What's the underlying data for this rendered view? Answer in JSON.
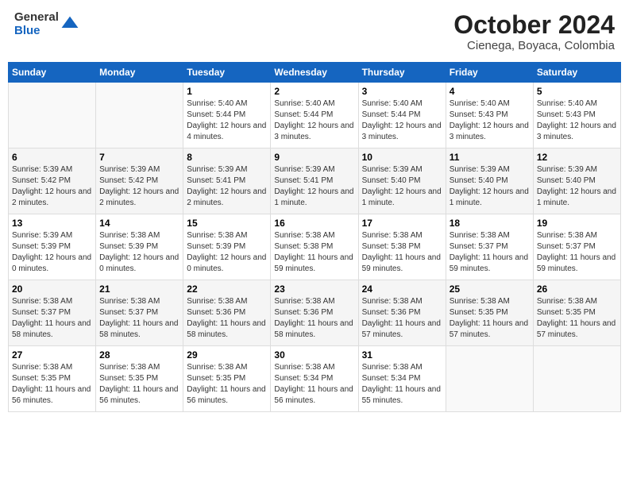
{
  "logo": {
    "general": "General",
    "blue": "Blue"
  },
  "header": {
    "month": "October 2024",
    "location": "Cienega, Boyaca, Colombia"
  },
  "weekdays": [
    "Sunday",
    "Monday",
    "Tuesday",
    "Wednesday",
    "Thursday",
    "Friday",
    "Saturday"
  ],
  "weeks": [
    [
      {
        "day": "",
        "info": ""
      },
      {
        "day": "",
        "info": ""
      },
      {
        "day": "1",
        "info": "Sunrise: 5:40 AM\nSunset: 5:44 PM\nDaylight: 12 hours and 4 minutes."
      },
      {
        "day": "2",
        "info": "Sunrise: 5:40 AM\nSunset: 5:44 PM\nDaylight: 12 hours and 3 minutes."
      },
      {
        "day": "3",
        "info": "Sunrise: 5:40 AM\nSunset: 5:44 PM\nDaylight: 12 hours and 3 minutes."
      },
      {
        "day": "4",
        "info": "Sunrise: 5:40 AM\nSunset: 5:43 PM\nDaylight: 12 hours and 3 minutes."
      },
      {
        "day": "5",
        "info": "Sunrise: 5:40 AM\nSunset: 5:43 PM\nDaylight: 12 hours and 3 minutes."
      }
    ],
    [
      {
        "day": "6",
        "info": "Sunrise: 5:39 AM\nSunset: 5:42 PM\nDaylight: 12 hours and 2 minutes."
      },
      {
        "day": "7",
        "info": "Sunrise: 5:39 AM\nSunset: 5:42 PM\nDaylight: 12 hours and 2 minutes."
      },
      {
        "day": "8",
        "info": "Sunrise: 5:39 AM\nSunset: 5:41 PM\nDaylight: 12 hours and 2 minutes."
      },
      {
        "day": "9",
        "info": "Sunrise: 5:39 AM\nSunset: 5:41 PM\nDaylight: 12 hours and 1 minute."
      },
      {
        "day": "10",
        "info": "Sunrise: 5:39 AM\nSunset: 5:40 PM\nDaylight: 12 hours and 1 minute."
      },
      {
        "day": "11",
        "info": "Sunrise: 5:39 AM\nSunset: 5:40 PM\nDaylight: 12 hours and 1 minute."
      },
      {
        "day": "12",
        "info": "Sunrise: 5:39 AM\nSunset: 5:40 PM\nDaylight: 12 hours and 1 minute."
      }
    ],
    [
      {
        "day": "13",
        "info": "Sunrise: 5:39 AM\nSunset: 5:39 PM\nDaylight: 12 hours and 0 minutes."
      },
      {
        "day": "14",
        "info": "Sunrise: 5:38 AM\nSunset: 5:39 PM\nDaylight: 12 hours and 0 minutes."
      },
      {
        "day": "15",
        "info": "Sunrise: 5:38 AM\nSunset: 5:39 PM\nDaylight: 12 hours and 0 minutes."
      },
      {
        "day": "16",
        "info": "Sunrise: 5:38 AM\nSunset: 5:38 PM\nDaylight: 11 hours and 59 minutes."
      },
      {
        "day": "17",
        "info": "Sunrise: 5:38 AM\nSunset: 5:38 PM\nDaylight: 11 hours and 59 minutes."
      },
      {
        "day": "18",
        "info": "Sunrise: 5:38 AM\nSunset: 5:37 PM\nDaylight: 11 hours and 59 minutes."
      },
      {
        "day": "19",
        "info": "Sunrise: 5:38 AM\nSunset: 5:37 PM\nDaylight: 11 hours and 59 minutes."
      }
    ],
    [
      {
        "day": "20",
        "info": "Sunrise: 5:38 AM\nSunset: 5:37 PM\nDaylight: 11 hours and 58 minutes."
      },
      {
        "day": "21",
        "info": "Sunrise: 5:38 AM\nSunset: 5:37 PM\nDaylight: 11 hours and 58 minutes."
      },
      {
        "day": "22",
        "info": "Sunrise: 5:38 AM\nSunset: 5:36 PM\nDaylight: 11 hours and 58 minutes."
      },
      {
        "day": "23",
        "info": "Sunrise: 5:38 AM\nSunset: 5:36 PM\nDaylight: 11 hours and 58 minutes."
      },
      {
        "day": "24",
        "info": "Sunrise: 5:38 AM\nSunset: 5:36 PM\nDaylight: 11 hours and 57 minutes."
      },
      {
        "day": "25",
        "info": "Sunrise: 5:38 AM\nSunset: 5:35 PM\nDaylight: 11 hours and 57 minutes."
      },
      {
        "day": "26",
        "info": "Sunrise: 5:38 AM\nSunset: 5:35 PM\nDaylight: 11 hours and 57 minutes."
      }
    ],
    [
      {
        "day": "27",
        "info": "Sunrise: 5:38 AM\nSunset: 5:35 PM\nDaylight: 11 hours and 56 minutes."
      },
      {
        "day": "28",
        "info": "Sunrise: 5:38 AM\nSunset: 5:35 PM\nDaylight: 11 hours and 56 minutes."
      },
      {
        "day": "29",
        "info": "Sunrise: 5:38 AM\nSunset: 5:35 PM\nDaylight: 11 hours and 56 minutes."
      },
      {
        "day": "30",
        "info": "Sunrise: 5:38 AM\nSunset: 5:34 PM\nDaylight: 11 hours and 56 minutes."
      },
      {
        "day": "31",
        "info": "Sunrise: 5:38 AM\nSunset: 5:34 PM\nDaylight: 11 hours and 55 minutes."
      },
      {
        "day": "",
        "info": ""
      },
      {
        "day": "",
        "info": ""
      }
    ]
  ]
}
